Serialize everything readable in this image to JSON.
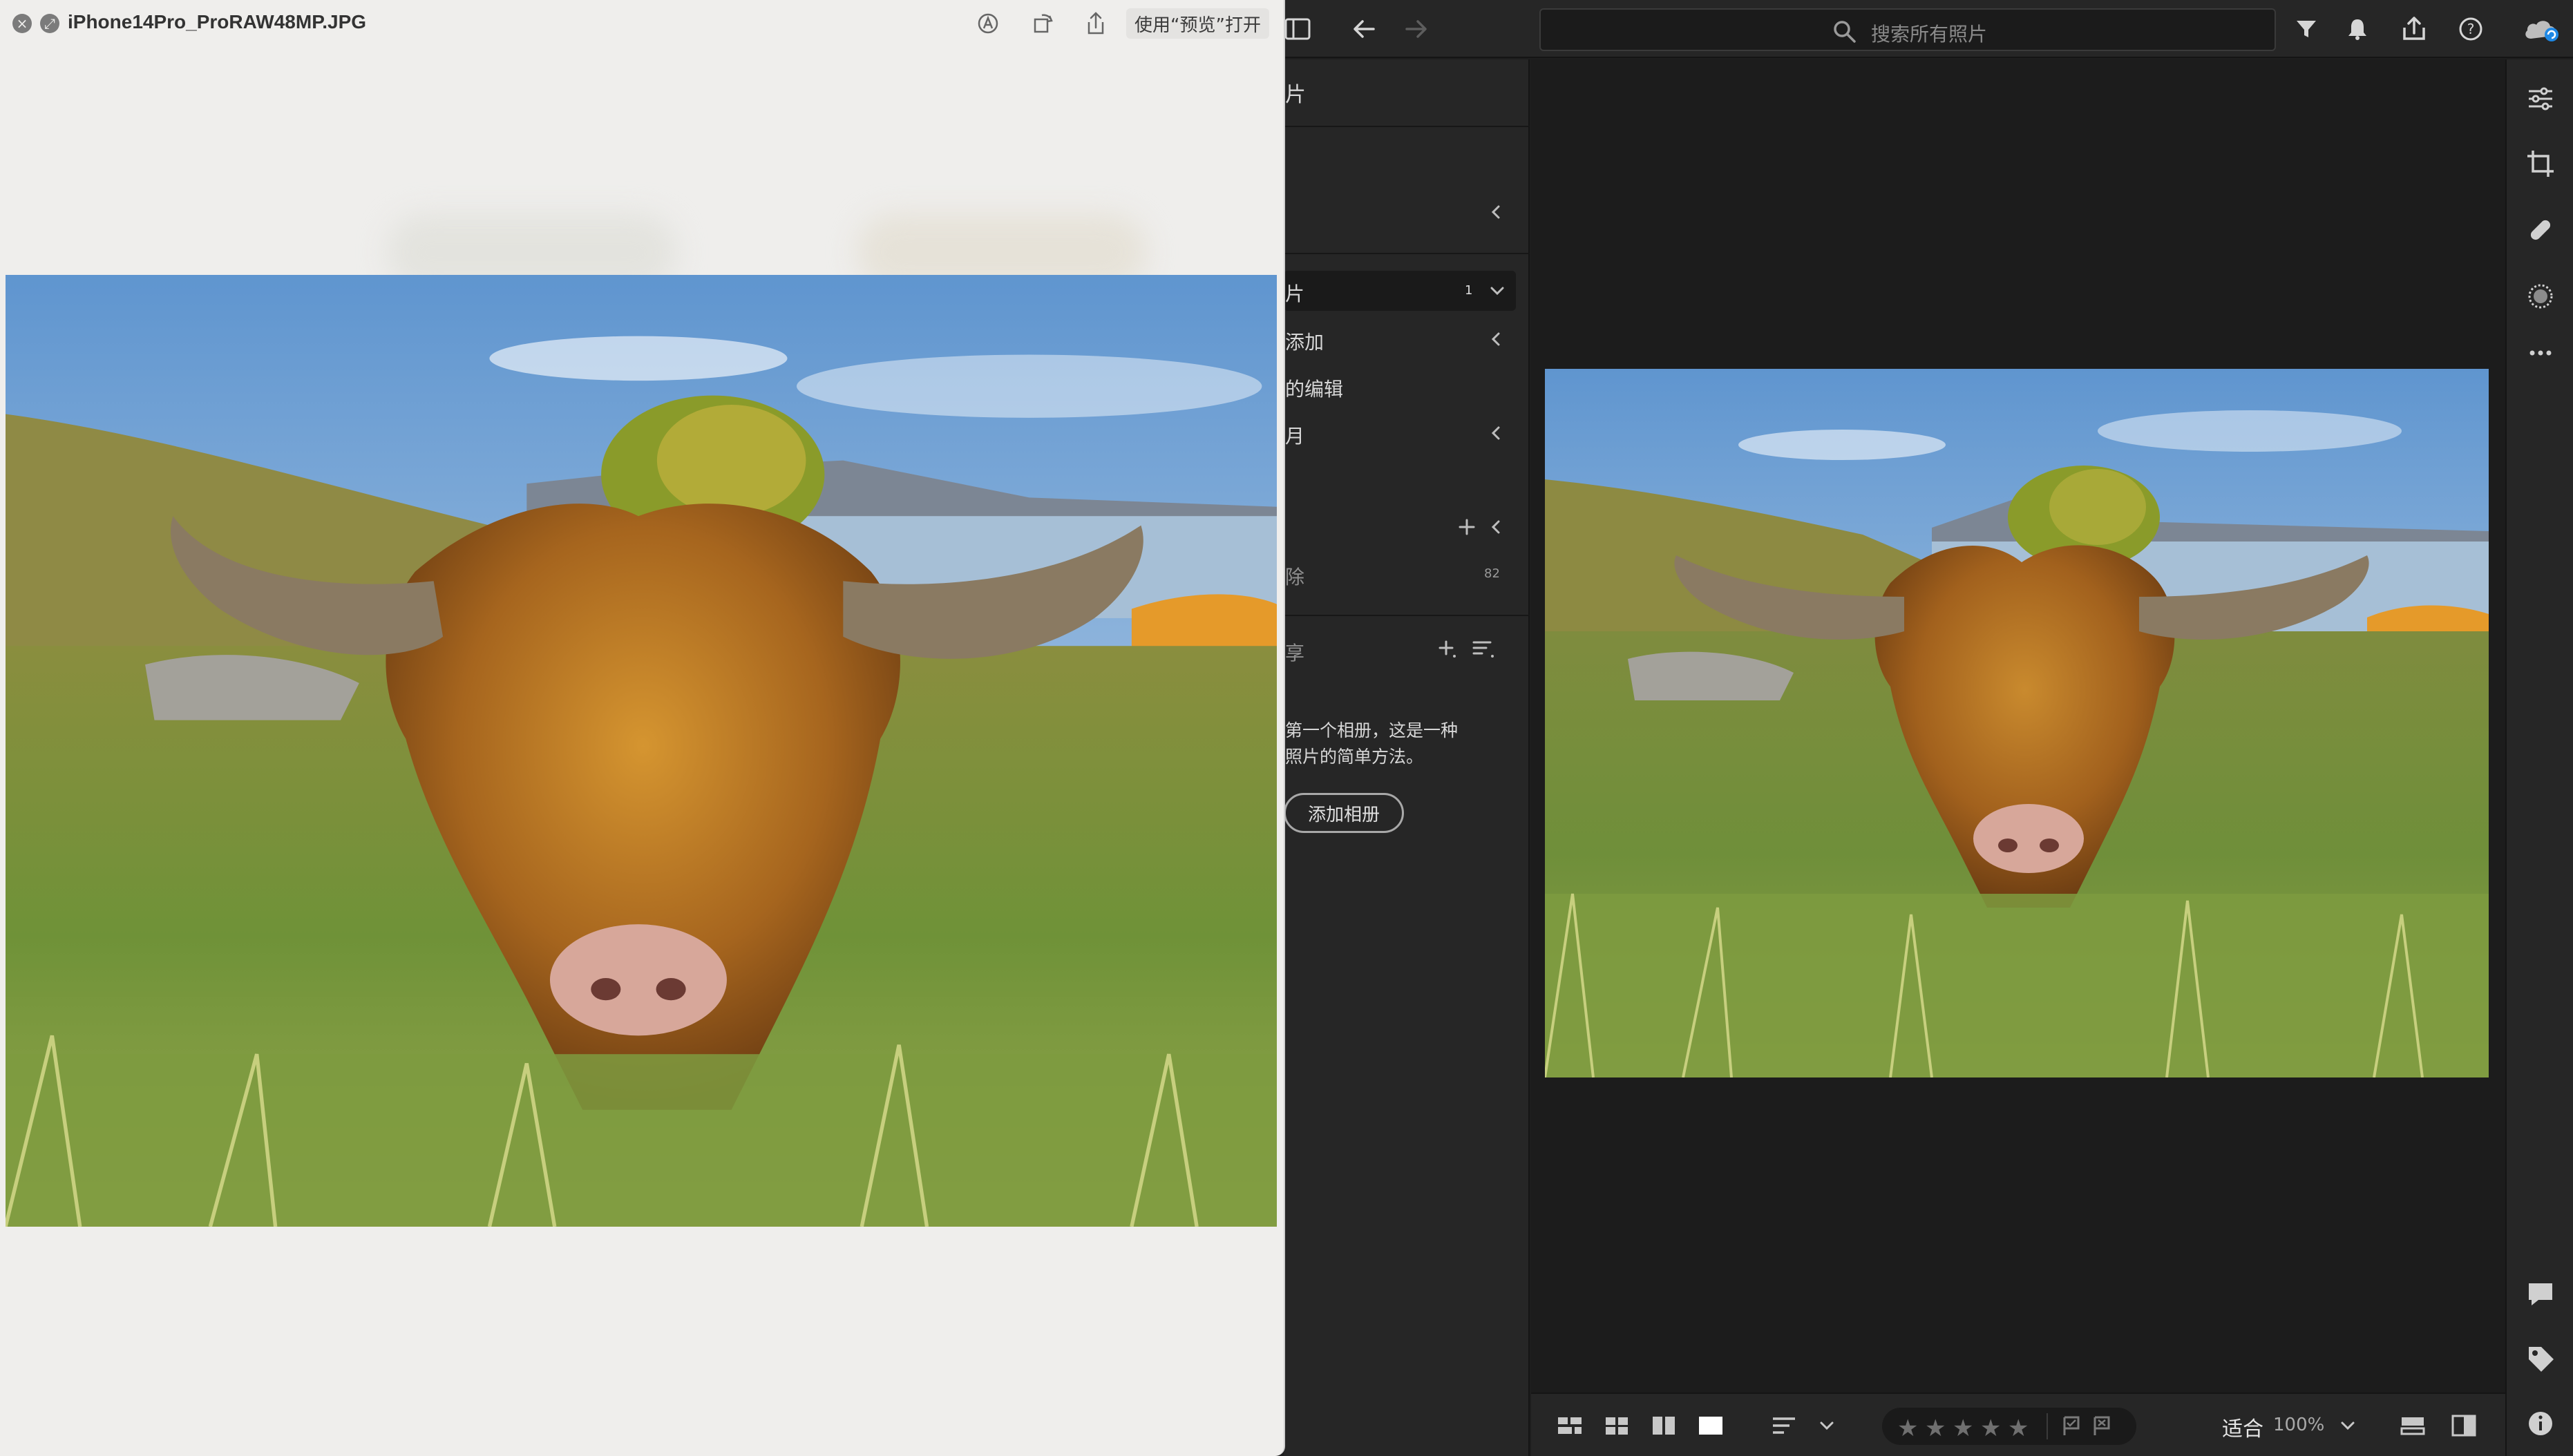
{
  "quicklook": {
    "filename": "iPhone14Pro_ProRAW48MP.JPG",
    "close_icon": "close-icon",
    "fullscreen_icon": "fullscreen-icon",
    "markup_icon": "markup-icon",
    "rotate_icon": "rotate-icon",
    "share_icon": "share-icon",
    "open_with_label": "使用“预览”打开"
  },
  "lightroom": {
    "toolbar": {
      "panel_toggle_icon": "panel-toggle-icon",
      "back_icon": "back-arrow-icon",
      "forward_icon": "forward-arrow-icon",
      "search_placeholder": "搜索所有照片",
      "filter_icon": "filter-icon",
      "notifications_icon": "bell-icon",
      "share_icon": "share-icon",
      "help_icon": "help-icon",
      "cloud_icon": "cloud-sync-icon"
    },
    "sidebar": {
      "header": "片",
      "item_selected": "片",
      "item_selected_count": "1",
      "item_added": "添加",
      "item_edited": "的编辑",
      "item_people": "月",
      "item_deleted": "除",
      "item_deleted_count": "82",
      "albums_header": "享",
      "albums_hint_line1": "第一个相册，这是一种",
      "albums_hint_line2": "照片的简单方法。",
      "add_album_button": "添加相册"
    },
    "rightbar": {
      "items": [
        "edit-sliders-icon",
        "crop-icon",
        "healing-icon",
        "masking-icon",
        "more-icon",
        "comment-icon",
        "tag-icon",
        "info-icon"
      ]
    },
    "bottombar": {
      "view_icons": [
        "square-grid-icon",
        "grid-icon",
        "detail-icon",
        "single-view-icon"
      ],
      "sort_icon": "sort-icon",
      "stars": [
        "★",
        "★",
        "★",
        "★",
        "★"
      ],
      "flag_pick_icon": "flag-pick-icon",
      "flag_reject_icon": "flag-reject-icon",
      "fit_label": "适合",
      "zoom_label": "100%",
      "compare_icon": "compare-icon",
      "split_view_icon": "split-view-icon"
    }
  }
}
